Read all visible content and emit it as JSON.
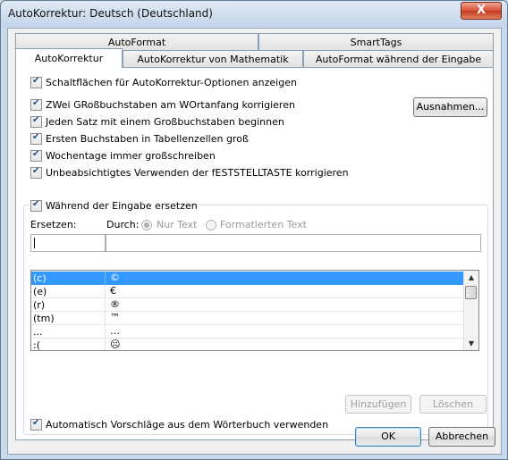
{
  "window": {
    "title": "AutoKorrektur: Deutsch (Deutschland)",
    "close_glyph": "X"
  },
  "tabs": {
    "row_back": [
      "AutoFormat",
      "SmartTags"
    ],
    "row_front": [
      "AutoKorrektur",
      "AutoKorrektur von Mathematik",
      "AutoFormat während der Eingabe"
    ],
    "active": "AutoKorrektur"
  },
  "options": {
    "show_buttons": "Schaltflächen für AutoKorrektur-Optionen anzeigen",
    "two_initial_caps": "ZWei GRoßbuchstaben am WOrtanfang korrigieren",
    "capitalize_sentence": "Jeden Satz mit einem Großbuchstaben beginnen",
    "capitalize_table_cells": "Ersten Buchstaben in Tabellenzellen groß",
    "capitalize_weekdays": "Wochentage immer großschreiben",
    "caps_lock": "Unbeabsichtigtes Verwenden der fESTSTELLTASTE korrigieren",
    "exceptions_button": "Ausnahmen..."
  },
  "replace": {
    "group_label": "Während der Eingabe ersetzen",
    "replace_label": "Ersetzen:",
    "with_label": "Durch:",
    "plain_text": "Nur Text",
    "formatted_text": "Formatierten Text",
    "replace_value": "",
    "with_value": "",
    "entries": [
      {
        "from": "(c)",
        "to": "©"
      },
      {
        "from": "(e)",
        "to": "€"
      },
      {
        "from": "(r)",
        "to": "®"
      },
      {
        "from": "(tm)",
        "to": "™"
      },
      {
        "from": "...",
        "to": "…"
      },
      {
        "from": ":(",
        "to": "☹"
      }
    ],
    "add_button": "Hinzufügen",
    "delete_button": "Löschen",
    "dictionary_suggestions": "Automatisch Vorschläge aus dem Wörterbuch verwenden"
  },
  "footer": {
    "ok": "OK",
    "cancel": "Abbrechen"
  }
}
